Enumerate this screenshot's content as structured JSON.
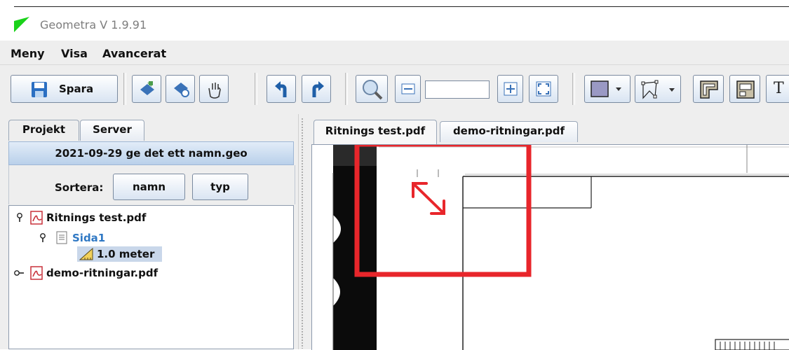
{
  "window": {
    "title": "Geometra V 1.9.91"
  },
  "menu": {
    "items": [
      "Meny",
      "Visa",
      "Avancerat"
    ]
  },
  "toolbar": {
    "save_label": "Spara",
    "zoom_value": ""
  },
  "left_panel": {
    "tabs": [
      "Projekt",
      "Server"
    ],
    "file_name": "2021-09-29 ge det ett namn.geo",
    "sort_label": "Sortera:",
    "sort_name": "namn",
    "sort_type": "typ",
    "tree": {
      "file1": "Ritnings test.pdf",
      "page1": "Sida1",
      "scale": "1.0 meter",
      "file2": "demo-ritningar.pdf"
    }
  },
  "document_tabs": [
    "Ritnings test.pdf",
    "demo-ritningar.pdf"
  ],
  "colors": {
    "accent": "#b9d0ea",
    "highlight_box": "#e8262b",
    "page_link": "#2f78c4",
    "selection": "#c9d7ea"
  }
}
